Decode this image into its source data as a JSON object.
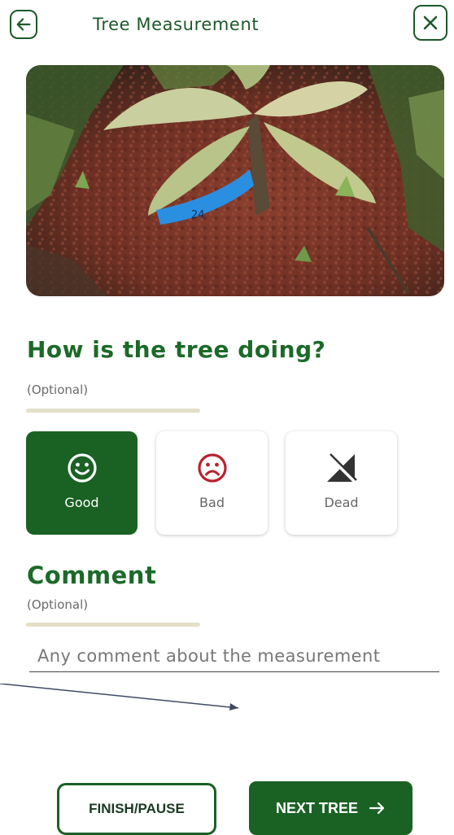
{
  "header": {
    "title": "Tree Measurement",
    "back_icon": "arrow-left-icon",
    "close_icon": "close-icon"
  },
  "photo": {
    "label_on_tape": "24"
  },
  "status": {
    "question": "How is the tree doing?",
    "optional_label": "(Optional)",
    "options": [
      {
        "label": "Good",
        "icon": "smiley-happy-icon",
        "selected": true
      },
      {
        "label": "Bad",
        "icon": "smiley-sad-icon",
        "selected": false
      },
      {
        "label": "Dead",
        "icon": "dead-signal-icon",
        "selected": false
      }
    ]
  },
  "comment": {
    "heading": "Comment",
    "optional_label": "(Optional)",
    "placeholder": "Any comment about the measurement",
    "value": ""
  },
  "actions": {
    "finish_label": "FINISH/PAUSE",
    "next_label": "NEXT TREE",
    "next_icon": "arrow-right-icon"
  },
  "colors": {
    "primary_green": "#1a6124",
    "heading_green": "#1b6a28",
    "bad_red": "#b8232e",
    "beige": "#e4dfc9"
  }
}
